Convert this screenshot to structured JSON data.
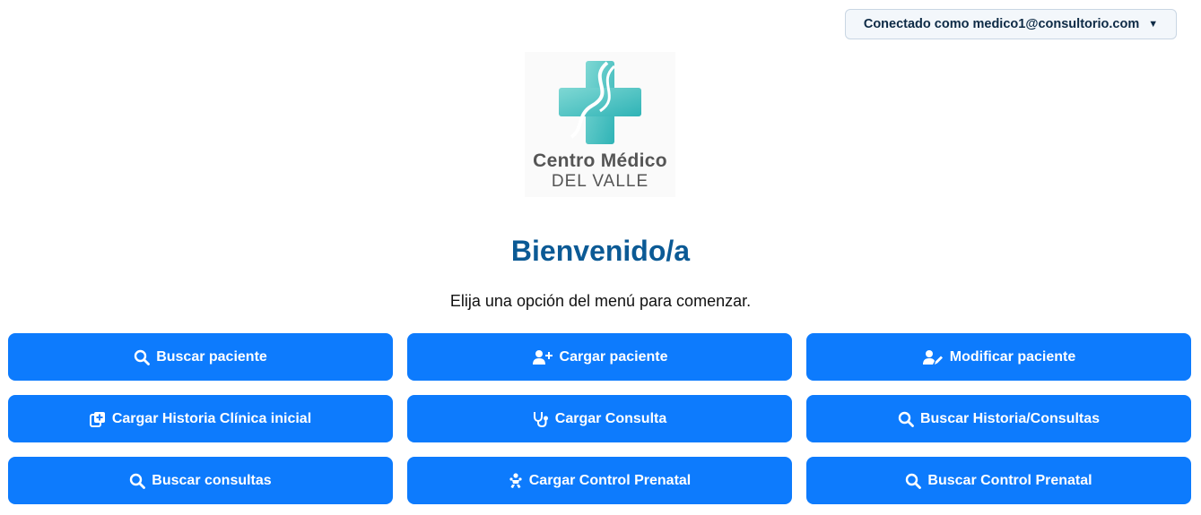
{
  "header": {
    "user_menu_label": "Conectado como medico1@consultorio.com",
    "caret": "▼"
  },
  "logo": {
    "line1": "Centro Médico",
    "line2": "DEL VALLE"
  },
  "main": {
    "title": "Bienvenido/a",
    "subtitle": "Elija una opción del menú para comenzar."
  },
  "menu": {
    "buscar_paciente": {
      "label": "Buscar paciente",
      "icon": "search-icon"
    },
    "cargar_paciente": {
      "label": "Cargar paciente",
      "icon": "user-plus-icon"
    },
    "modificar_paciente": {
      "label": "Modificar paciente",
      "icon": "user-edit-icon"
    },
    "cargar_historia": {
      "label": "Cargar Historia Clínica inicial",
      "icon": "notes-medical-icon"
    },
    "cargar_consulta": {
      "label": "Cargar Consulta",
      "icon": "stethoscope-icon"
    },
    "buscar_historia": {
      "label": "Buscar Historia/Consultas",
      "icon": "search-icon"
    },
    "buscar_consultas": {
      "label": "Buscar consultas",
      "icon": "search-icon"
    },
    "cargar_prenatal": {
      "label": "Cargar Control Prenatal",
      "icon": "baby-icon"
    },
    "buscar_prenatal": {
      "label": "Buscar Control Prenatal",
      "icon": "search-icon"
    }
  },
  "colors": {
    "button_bg": "#0d7bfd",
    "title": "#0b5a95",
    "logo_teal": "#3dbfbf"
  }
}
